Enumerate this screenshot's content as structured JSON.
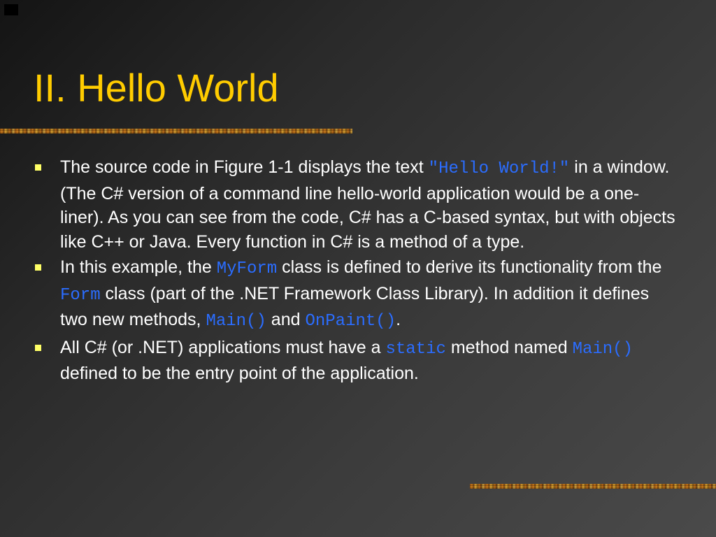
{
  "slide": {
    "title": "II. Hello World",
    "bullets": [
      {
        "segments": [
          {
            "text": "The source code in Figure 1-1 displays the text ",
            "code": false
          },
          {
            "text": "\"Hello World!\"",
            "code": true
          },
          {
            "text": " in a window.  (The C# version of a command line hello-world application would be a one-liner).  As you can see from the code, C# has a C-based syntax, but with objects like C++ or Java.  Every function in C# is a method of a type.",
            "code": false
          }
        ]
      },
      {
        "segments": [
          {
            "text": "In this example, the ",
            "code": false
          },
          {
            "text": "MyForm",
            "code": true
          },
          {
            "text": " class is defined to derive its functionality from the ",
            "code": false
          },
          {
            "text": "Form",
            "code": true
          },
          {
            "text": " class (part of the .NET Framework Class Library).  In addition it defines two new methods, ",
            "code": false
          },
          {
            "text": "Main()",
            "code": true
          },
          {
            "text": " and ",
            "code": false
          },
          {
            "text": "OnPaint()",
            "code": true
          },
          {
            "text": ".",
            "code": false
          }
        ]
      },
      {
        "segments": [
          {
            "text": "All C# (or .NET) applications must have a ",
            "code": false
          },
          {
            "text": "static",
            "code": true
          },
          {
            "text": " method named ",
            "code": false
          },
          {
            "text": "Main()",
            "code": true
          },
          {
            "text": " defined to be the entry point of the application.",
            "code": false
          }
        ]
      }
    ]
  },
  "colors": {
    "title": "#ffcc00",
    "body_text": "#ffffff",
    "code_text": "#2b6dff",
    "bullet_marker": "#ffff66",
    "background_dark": "#141414",
    "background_light": "#4a4a4a"
  }
}
